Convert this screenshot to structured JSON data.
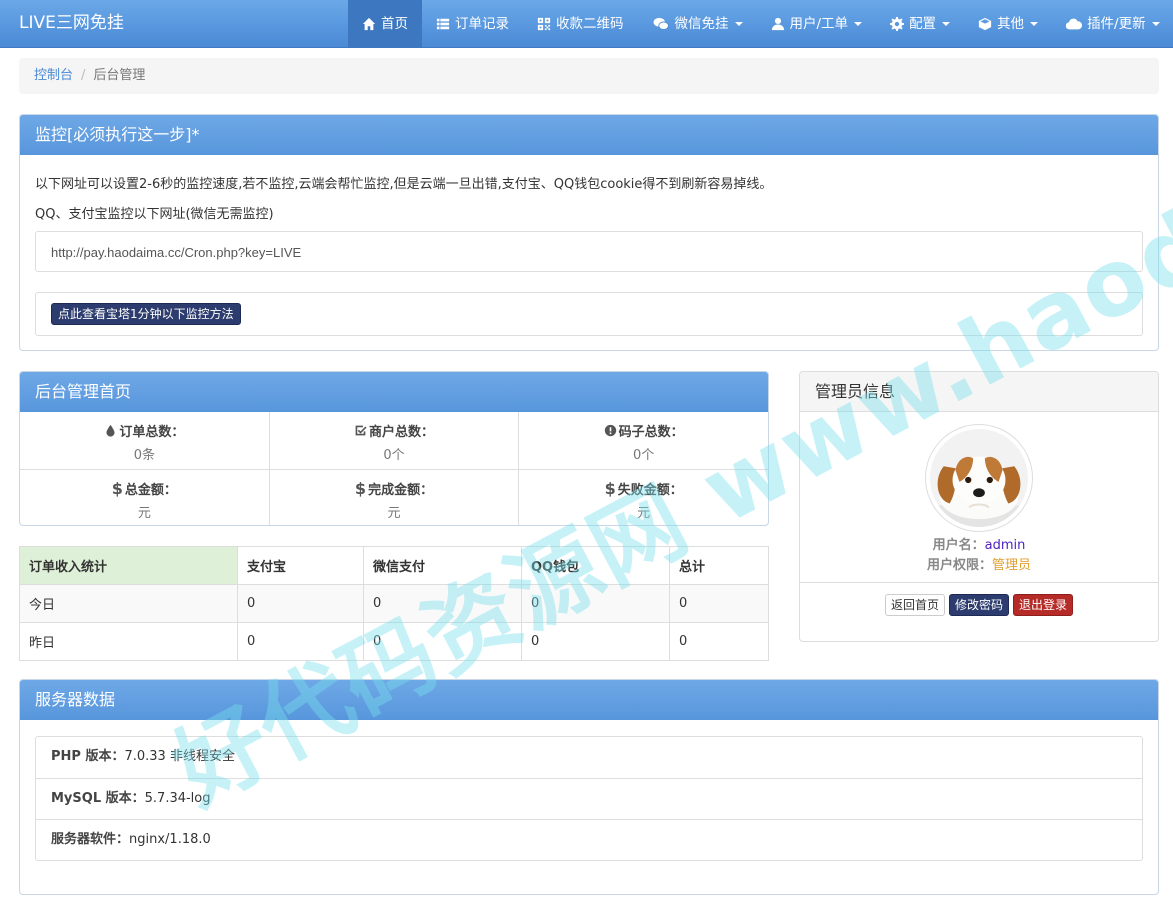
{
  "navbar": {
    "brand": "LIVE三网免挂",
    "items": [
      {
        "label": "首页",
        "icon": "home-icon",
        "active": true
      },
      {
        "label": "订单记录",
        "icon": "list-icon"
      },
      {
        "label": "收款二维码",
        "icon": "qrcode-icon"
      },
      {
        "label": "微信免挂",
        "icon": "wechat-icon",
        "dropdown": true
      },
      {
        "label": "用户/工单",
        "icon": "user-icon",
        "dropdown": true
      },
      {
        "label": "配置",
        "icon": "gear-icon",
        "dropdown": true
      },
      {
        "label": "其他",
        "icon": "cube-icon",
        "dropdown": true
      },
      {
        "label": "插件/更新",
        "icon": "cloud-icon",
        "dropdown": true
      }
    ]
  },
  "breadcrumb": {
    "home": "控制台",
    "current": "后台管理"
  },
  "monitor": {
    "title": "监控[必须执行这一步]*",
    "line1": "以下网址可以设置2-6秒的监控速度,若不监控,云端会帮忙监控,但是云端一旦出错,支付宝、QQ钱包cookie得不到刷新容易掉线。",
    "line2": "QQ、支付宝监控以下网址(微信无需监控)",
    "url": "http://pay.haodaima.cc/Cron.php?key=LIVE",
    "button": "点此查看宝塔1分钟以下监控方法"
  },
  "stats": {
    "title": "后台管理首页",
    "cells": [
      {
        "label": "订单总数：",
        "value": "0条",
        "icon": "drop-icon"
      },
      {
        "label": "商户总数：",
        "value": "0个",
        "icon": "check-square-icon"
      },
      {
        "label": "码子总数：",
        "value": "0个",
        "icon": "exclamation-circle-icon"
      },
      {
        "label": "总金额：",
        "value": "元",
        "icon": "dollar-icon"
      },
      {
        "label": "完成金额：",
        "value": "元",
        "icon": "dollar-icon"
      },
      {
        "label": "失败金额：",
        "value": "元",
        "icon": "dollar-icon"
      }
    ]
  },
  "income": {
    "headers": [
      "订单收入统计",
      "支付宝",
      "微信支付",
      "QQ钱包",
      "总计"
    ],
    "rows": [
      [
        "今日",
        "0",
        "0",
        "0",
        "0"
      ],
      [
        "昨日",
        "0",
        "0",
        "0",
        "0"
      ]
    ]
  },
  "admin": {
    "title": "管理员信息",
    "username_label": "用户名：",
    "username": "admin",
    "role_label": "用户权限：",
    "role": "管理员",
    "buttons": {
      "home": "返回首页",
      "password": "修改密码",
      "logout": "退出登录"
    }
  },
  "server": {
    "title": "服务器数据",
    "items": [
      {
        "label": "PHP 版本：",
        "value": "7.0.33 非线程安全"
      },
      {
        "label": "MySQL 版本：",
        "value": "5.7.34-log"
      },
      {
        "label": "服务器软件：",
        "value": "nginx/1.18.0"
      }
    ]
  },
  "watermark": "好代码资源网 www.haodaima.cc",
  "colors": {
    "primary": "#5896dc",
    "nav_active": "#3c77c0",
    "dark_button": "#2d3c6e",
    "danger": "#b52b27",
    "success_bg": "#dff0d8"
  }
}
